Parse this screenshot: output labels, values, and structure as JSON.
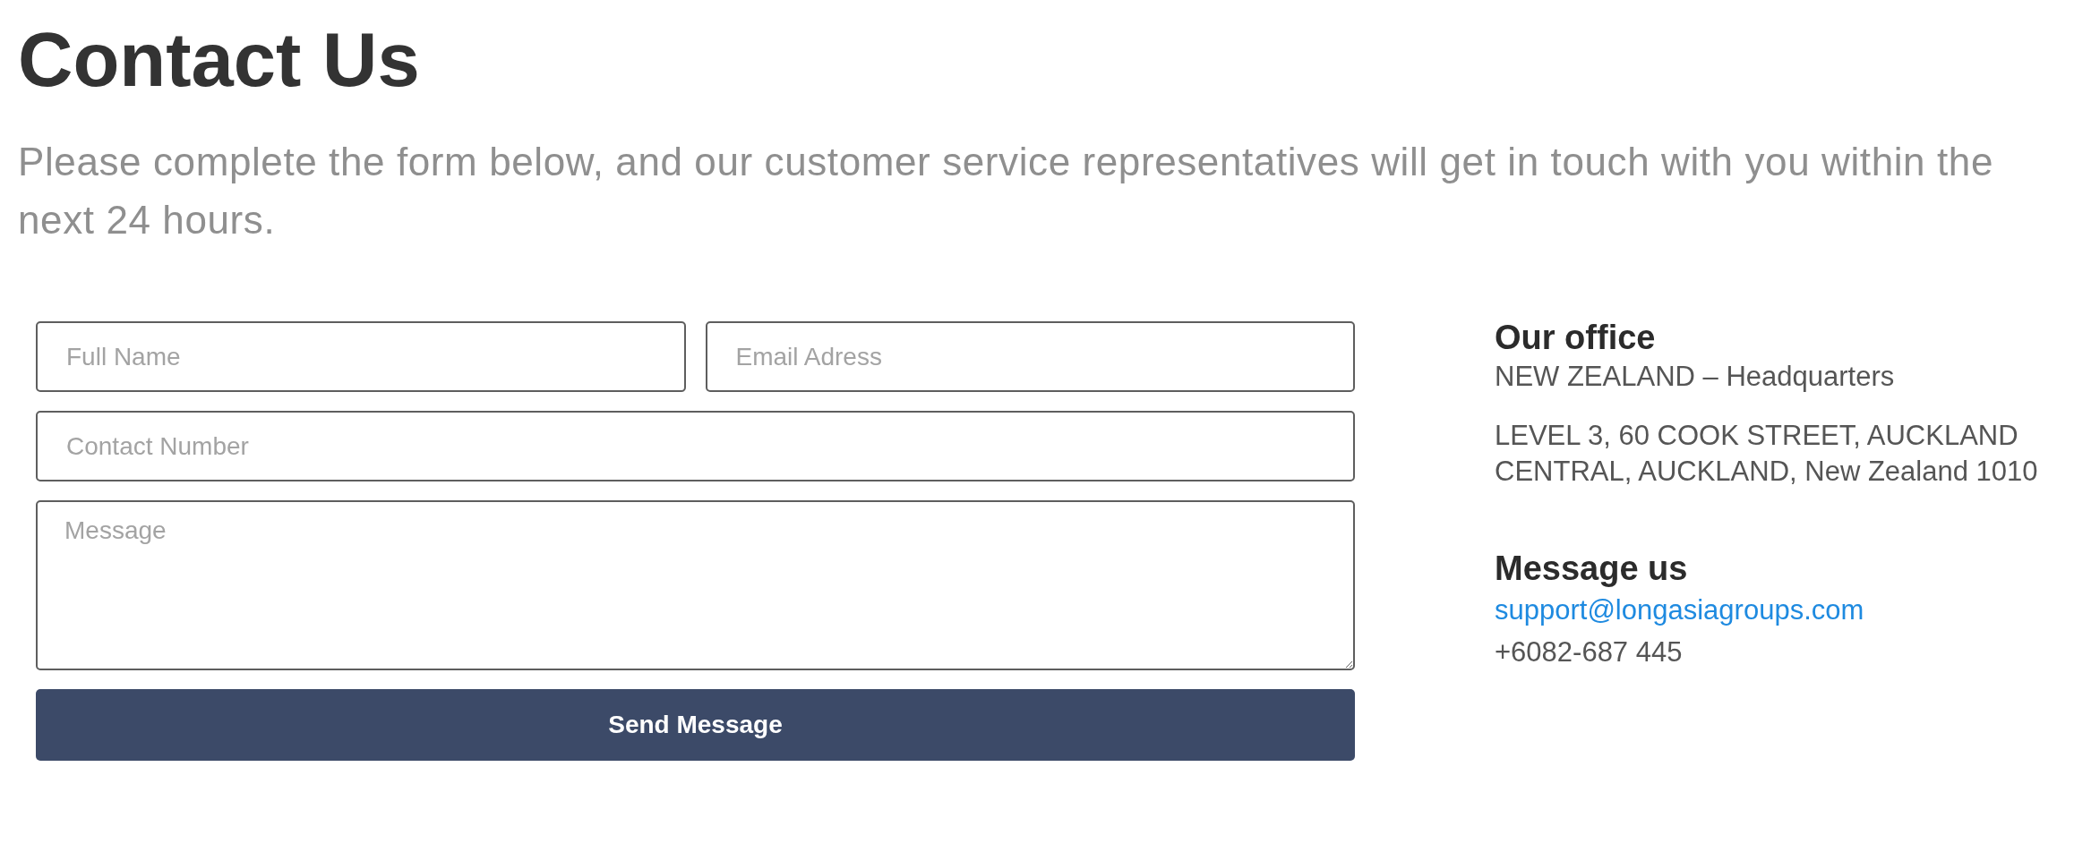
{
  "page": {
    "title": "Contact Us",
    "intro": "Please complete the form below, and our customer service representatives will get in touch with you within the next 24 hours."
  },
  "form": {
    "rows": [
      [
        {
          "kind": "input",
          "placeholder": "Full Name"
        },
        {
          "kind": "input",
          "placeholder": "Email Adress"
        }
      ],
      [
        {
          "kind": "input",
          "placeholder": "Contact Number"
        }
      ],
      [
        {
          "kind": "textarea",
          "placeholder": "Message"
        }
      ]
    ],
    "submit": "Send Message"
  },
  "office": {
    "heading": "Our office",
    "name": "NEW ZEALAND – Headquarters",
    "address": "LEVEL 3, 60 COOK STREET, AUCKLAND\nCENTRAL, AUCKLAND, New Zealand 1010"
  },
  "message_us": {
    "heading": "Message us",
    "email": "support@longasiagroups.com",
    "phone": "+6082-687 445"
  }
}
